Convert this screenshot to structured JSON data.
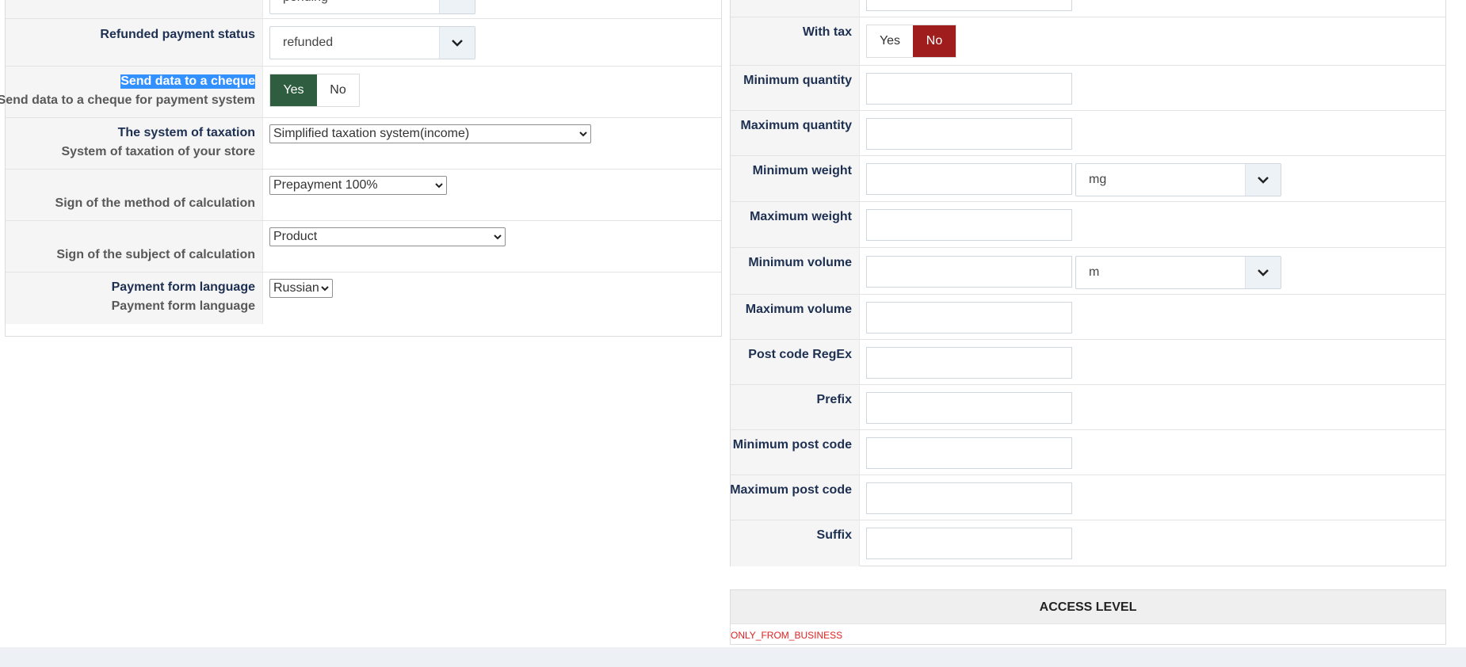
{
  "left": {
    "top_select_value": "pending",
    "refunded_status": {
      "label": "Refunded payment status",
      "value": "refunded"
    },
    "send_cheque": {
      "label": "Send data to a cheque",
      "desc": "Send data to a cheque for payment system",
      "yes": "Yes",
      "no": "No",
      "active": "yes"
    },
    "taxation": {
      "label": "The system of taxation",
      "desc": "System of taxation of your store",
      "value": "Simplified taxation system(income)"
    },
    "method_calc": {
      "desc": "Sign of the method of calculation",
      "value": "Prepayment 100%"
    },
    "subject_calc": {
      "desc": "Sign of the subject of calculation",
      "value": "Product"
    },
    "language": {
      "label": "Payment form language",
      "desc": "Payment form language",
      "value": "Russian"
    }
  },
  "right": {
    "with_tax": {
      "label": "With tax",
      "yes": "Yes",
      "no": "No",
      "active": "no"
    },
    "min_quantity": {
      "label": "Minimum quantity",
      "value": ""
    },
    "max_quantity": {
      "label": "Maximum quantity",
      "value": ""
    },
    "min_weight": {
      "label": "Minimum weight",
      "value": "",
      "unit": "mg"
    },
    "max_weight": {
      "label": "Maximum weight",
      "value": ""
    },
    "min_volume": {
      "label": "Minimum volume",
      "value": "",
      "unit": "m"
    },
    "max_volume": {
      "label": "Maximum volume",
      "value": ""
    },
    "postcode_regex": {
      "label": "Post code RegEx",
      "value": ""
    },
    "prefix": {
      "label": "Prefix",
      "value": ""
    },
    "min_postcode": {
      "label": "Minimum post code",
      "value": ""
    },
    "max_postcode": {
      "label": "Maximum post code",
      "value": ""
    },
    "suffix": {
      "label": "Suffix",
      "value": ""
    }
  },
  "access": {
    "title": "ACCESS LEVEL",
    "note": "ONLY_FROM_BUSINESS"
  },
  "colors": {
    "yes_active": "#2f5d3f",
    "no_active": "#a01d1d",
    "note": "#e02020"
  },
  "icons": {
    "dropdown": "chevron-down-icon"
  }
}
